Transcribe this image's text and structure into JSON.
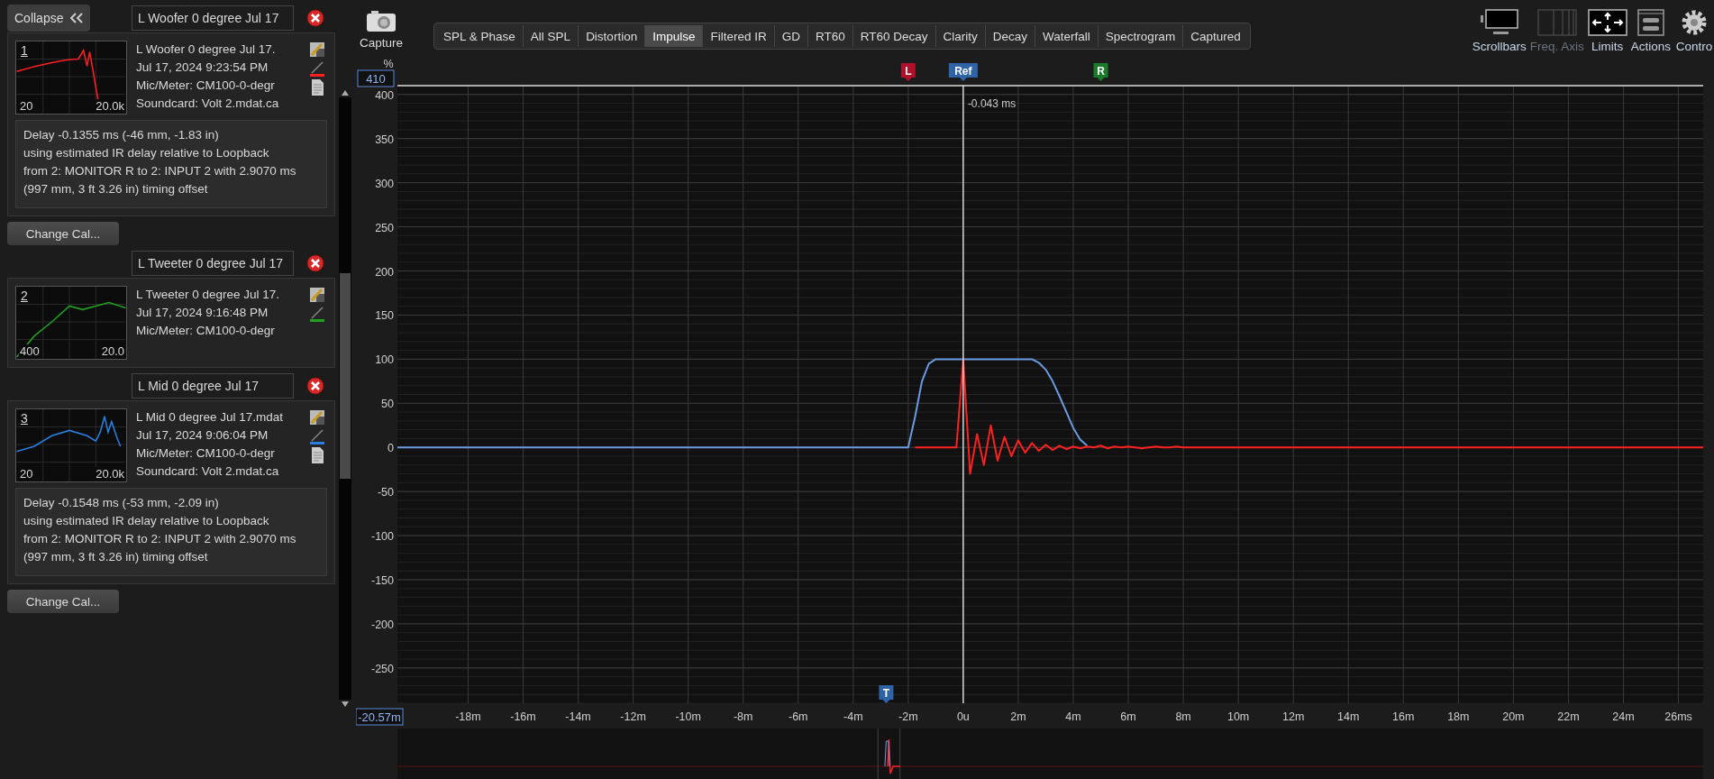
{
  "panel": {
    "collapse_button": "Collapse"
  },
  "cards": [
    {
      "title": "L Woofer 0 degree Jul 17",
      "number": "1",
      "axis_min": "20",
      "axis_max": "20.0k",
      "color": "#ff2020",
      "file": "L Woofer 0 degree Jul 17.",
      "date": "Jul 17, 2024 9:23:54 PM",
      "mic": "Mic/Meter: CM100-0-degr",
      "soundcard": "Soundcard: Volt 2.mdat.ca",
      "delay": "Delay -0.1355 ms (-46 mm, -1.83 in)\nusing estimated IR delay relative to Loopback\nfrom 2: MONITOR R to 2: INPUT 2 with 2.9070 ms\n(997 mm, 3 ft 3.26 in) timing offset",
      "button": "Change Cal..."
    },
    {
      "title": "L Tweeter 0 degree Jul 17",
      "number": "2",
      "axis_min": "400",
      "axis_max": "20.0",
      "color": "#22a022",
      "file": "L Tweeter 0 degree Jul 17.",
      "date": "Jul 17, 2024 9:16:48 PM",
      "mic": "Mic/Meter: CM100-0-degr"
    },
    {
      "title": "L Mid 0 degree Jul 17",
      "number": "3",
      "axis_min": "20",
      "axis_max": "20.0k",
      "color": "#2a7fe0",
      "file": "L Mid 0 degree Jul 17.mdat",
      "date": "Jul 17, 2024 9:06:04 PM",
      "mic": "Mic/Meter: CM100-0-degr",
      "soundcard": "Soundcard: Volt 2.mdat.ca",
      "delay": "Delay -0.1548 ms (-53 mm, -2.09 in)\nusing estimated IR delay relative to Loopback\nfrom 2: MONITOR R to 2: INPUT 2 with 2.9070 ms\n(997 mm, 3 ft 3.26 in) timing offset",
      "button": "Change Cal..."
    }
  ],
  "toolbar": {
    "capture": "Capture",
    "tabs": [
      {
        "label": "SPL & Phase",
        "selected": false
      },
      {
        "label": "All SPL",
        "selected": false
      },
      {
        "label": "Distortion",
        "selected": false
      },
      {
        "label": "Impulse",
        "selected": true
      },
      {
        "label": "Filtered IR",
        "selected": false
      },
      {
        "label": "GD",
        "selected": false
      },
      {
        "label": "RT60",
        "selected": false
      },
      {
        "label": "RT60 Decay",
        "selected": false
      },
      {
        "label": "Clarity",
        "selected": false
      },
      {
        "label": "Decay",
        "selected": false
      },
      {
        "label": "Waterfall",
        "selected": false
      },
      {
        "label": "Spectrogram",
        "selected": false
      },
      {
        "label": "Captured",
        "selected": false
      }
    ],
    "tools": [
      {
        "kind": "scrollbars",
        "label": "Scrollbars",
        "disabled": false
      },
      {
        "kind": "axis",
        "label": "Freq. Axis",
        "disabled": true
      },
      {
        "kind": "limits",
        "label": "Limits",
        "disabled": false
      },
      {
        "kind": "actions",
        "label": "Actions",
        "disabled": false
      },
      {
        "kind": "controls",
        "label": "Contro",
        "disabled": false
      }
    ]
  },
  "chart": {
    "y_unit": "%",
    "y_top_field": "410",
    "x_left_field": "-20.57m",
    "chart_data": {
      "type": "line",
      "x": [
        -20.57,
        -3,
        -2.75,
        -2.5,
        -2.25,
        -2,
        -1.75,
        -1.5,
        -1.25,
        -1,
        -0.75,
        -0.5,
        -0.25,
        0,
        0.25,
        0.5,
        0.75,
        1,
        1.25,
        1.5,
        1.75,
        2,
        2.25,
        2.5,
        2.75,
        3,
        3.25,
        3.5,
        3.75,
        4,
        4.25,
        4.5,
        4.75,
        5,
        5.25,
        5.5,
        5.75,
        6,
        6.25,
        6.5,
        6.75,
        7,
        7.25,
        7.5,
        7.75,
        8,
        26.9
      ],
      "series": [
        {
          "color": "#6a9be0",
          "values": [
            0,
            0,
            0,
            0,
            0,
            0,
            35,
            75,
            95,
            100,
            100,
            100,
            100,
            100,
            100,
            100,
            100,
            100,
            100,
            100,
            100,
            100,
            100,
            100,
            96,
            88,
            75,
            58,
            40,
            22,
            9,
            2,
            null,
            null,
            null,
            null,
            null,
            null,
            null,
            null,
            null,
            null,
            null,
            null,
            null,
            null,
            null
          ]
        },
        {
          "color": "#ff2020",
          "values": [
            null,
            null,
            null,
            null,
            null,
            null,
            0,
            0,
            0,
            0,
            0,
            0,
            0,
            100,
            -30,
            15,
            -20,
            25,
            -15,
            12,
            -10,
            8,
            -6,
            5,
            -4,
            3,
            -3,
            2,
            -2,
            1,
            -1,
            1,
            0,
            2,
            -1,
            1,
            0,
            1,
            0,
            -1,
            0,
            1,
            0,
            0,
            1,
            0,
            0
          ]
        }
      ],
      "grid": true,
      "xlim": [
        -20.57,
        26.9
      ],
      "ylim": [
        -290,
        410
      ],
      "xticks": [
        {
          "value": -18,
          "label": "-18m"
        },
        {
          "value": -16,
          "label": "-16m"
        },
        {
          "value": -14,
          "label": "-14m"
        },
        {
          "value": -12,
          "label": "-12m"
        },
        {
          "value": -10,
          "label": "-10m"
        },
        {
          "value": -8,
          "label": "-8m"
        },
        {
          "value": -6,
          "label": "-6m"
        },
        {
          "value": -4,
          "label": "-4m"
        },
        {
          "value": -2,
          "label": "-2m"
        },
        {
          "value": 0,
          "label": "0u"
        },
        {
          "value": 2,
          "label": "2m"
        },
        {
          "value": 4,
          "label": "4m"
        },
        {
          "value": 6,
          "label": "6m"
        },
        {
          "value": 8,
          "label": "8m"
        },
        {
          "value": 10,
          "label": "10m"
        },
        {
          "value": 12,
          "label": "12m"
        },
        {
          "value": 14,
          "label": "14m"
        },
        {
          "value": 16,
          "label": "16m"
        },
        {
          "value": 18,
          "label": "18m"
        },
        {
          "value": 20,
          "label": "20m"
        },
        {
          "value": 22,
          "label": "22m"
        },
        {
          "value": 24,
          "label": "24m"
        },
        {
          "value": 26,
          "label": "26ms"
        }
      ],
      "yticks": [
        400,
        350,
        300,
        250,
        200,
        150,
        100,
        50,
        0,
        -50,
        -100,
        -150,
        -200,
        -250
      ]
    },
    "markers": [
      {
        "kind": "window-start",
        "label": "L",
        "color": "#b0102a"
      },
      {
        "kind": "ref",
        "label": "Ref",
        "color": "#2f63a8"
      },
      {
        "kind": "window-end",
        "label": "R",
        "color": "#1a7a2a"
      },
      {
        "kind": "readout",
        "label": "-0.043 ms"
      },
      {
        "kind": "taper",
        "label": "T",
        "color": "#2f63a8"
      }
    ]
  }
}
